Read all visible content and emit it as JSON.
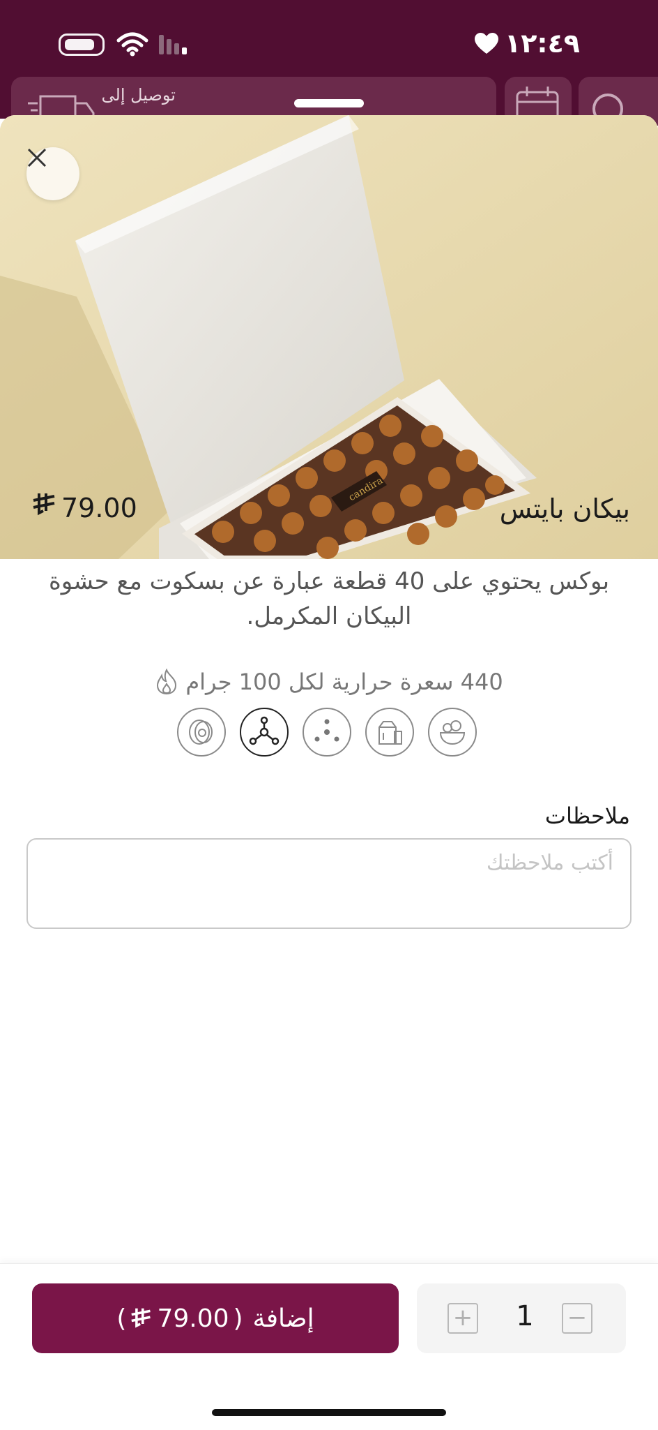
{
  "status_bar": {
    "time": "١٢:٤٩"
  },
  "header": {
    "delivery_label": "توصيل إلى"
  },
  "product": {
    "title": "بيكان بايتس",
    "price": "79.00",
    "currency_symbol": "⃁",
    "description": "بوكس يحتوي على 40 قطعة عبارة عن بسكوت  مع حشوة البيكان المكرمل.",
    "calories": "440 سعرة حرارية لكل 100 جرام",
    "allergens": [
      {
        "icon": "nuts-bowl-icon"
      },
      {
        "icon": "milk-icon"
      },
      {
        "icon": "sesame-icon"
      },
      {
        "icon": "molecule-icon",
        "active": true
      },
      {
        "icon": "egg-icon"
      }
    ]
  },
  "notes": {
    "label": "ملاحظات",
    "placeholder": "أكتب ملاحظتك",
    "value": ""
  },
  "footer": {
    "add_label": "إضافة",
    "add_price": "79.00",
    "quantity": "1",
    "plus_label": "+",
    "minus_label": "−"
  },
  "colors": {
    "brand": "#510e32",
    "button": "#7a1548"
  }
}
